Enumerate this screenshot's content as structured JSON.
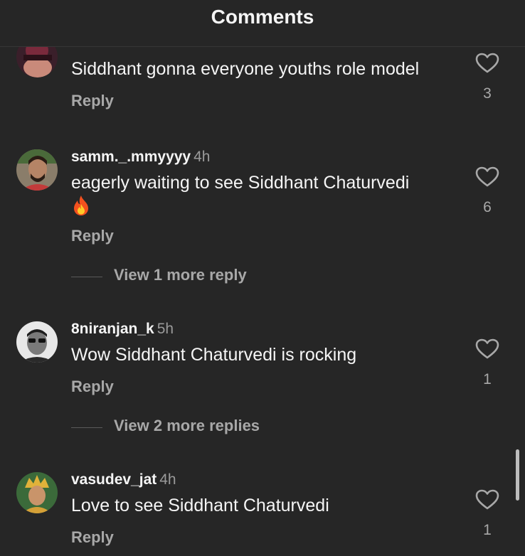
{
  "header": {
    "title": "Comments"
  },
  "comments": [
    {
      "username": "",
      "time": "",
      "text": "Siddhant gonna everyone youths role model",
      "reply_label": "Reply",
      "likes": "3"
    },
    {
      "username": "samm._.mmyyyy",
      "time": "4h",
      "text": "eagerly waiting to see Siddhant Chaturvedi",
      "emoji": "fire-emoji",
      "reply_label": "Reply",
      "likes": "6",
      "view_more": "View 1 more reply"
    },
    {
      "username": "8niranjan_k",
      "time": "5h",
      "text": "Wow Siddhant Chaturvedi is rocking",
      "reply_label": "Reply",
      "likes": "1",
      "view_more": "View 2 more replies"
    },
    {
      "username": "vasudev_jat",
      "time": "4h",
      "text": "Love to see Siddhant Chaturvedi",
      "reply_label": "Reply",
      "likes": "1"
    }
  ]
}
